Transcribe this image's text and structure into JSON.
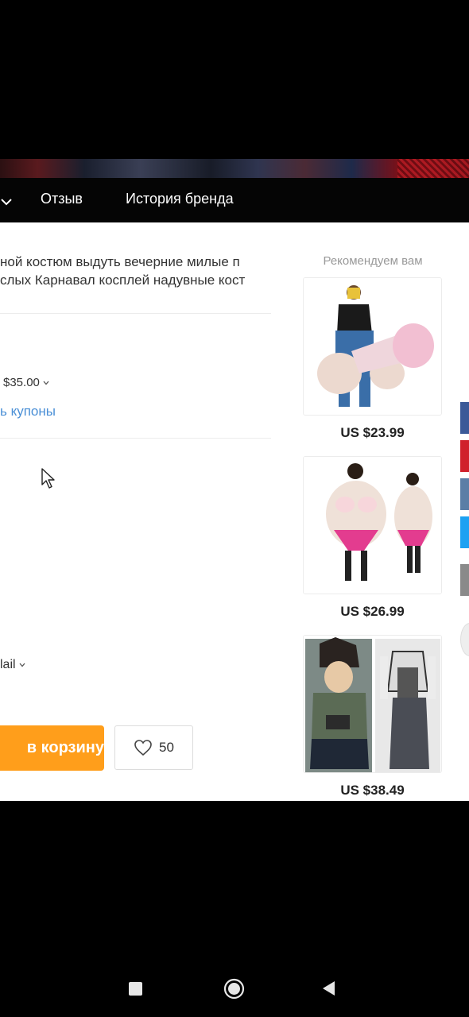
{
  "nav": {
    "items": [
      "Отзыв",
      "История бренда"
    ]
  },
  "product": {
    "title_lines": [
      "ной костюм выдуть вечерние милые п",
      "слых Карнавал косплей надувные кост"
    ],
    "price_selector": "$35.00",
    "coupon_link": "ь купоны",
    "shipping_selector": "lail",
    "add_to_cart": "в корзину",
    "wishlist_count": "50"
  },
  "recommendations": {
    "title": "Рекомендуем вам",
    "items": [
      {
        "price": "US $23.99"
      },
      {
        "price": "US $26.99"
      },
      {
        "price": "US $38.49"
      }
    ]
  },
  "colors": {
    "cart_button": "#ff9e1b",
    "coupon_link": "#4a8fd6",
    "social_blue": "#3b5998",
    "social_red": "#d0212b",
    "social_steel": "#5b7ea6",
    "social_cyan": "#1da1f2"
  },
  "icons": [
    "chevron-down-icon",
    "heart-icon",
    "cursor-icon",
    "recents-square-icon",
    "home-circle-icon",
    "back-triangle-icon"
  ]
}
